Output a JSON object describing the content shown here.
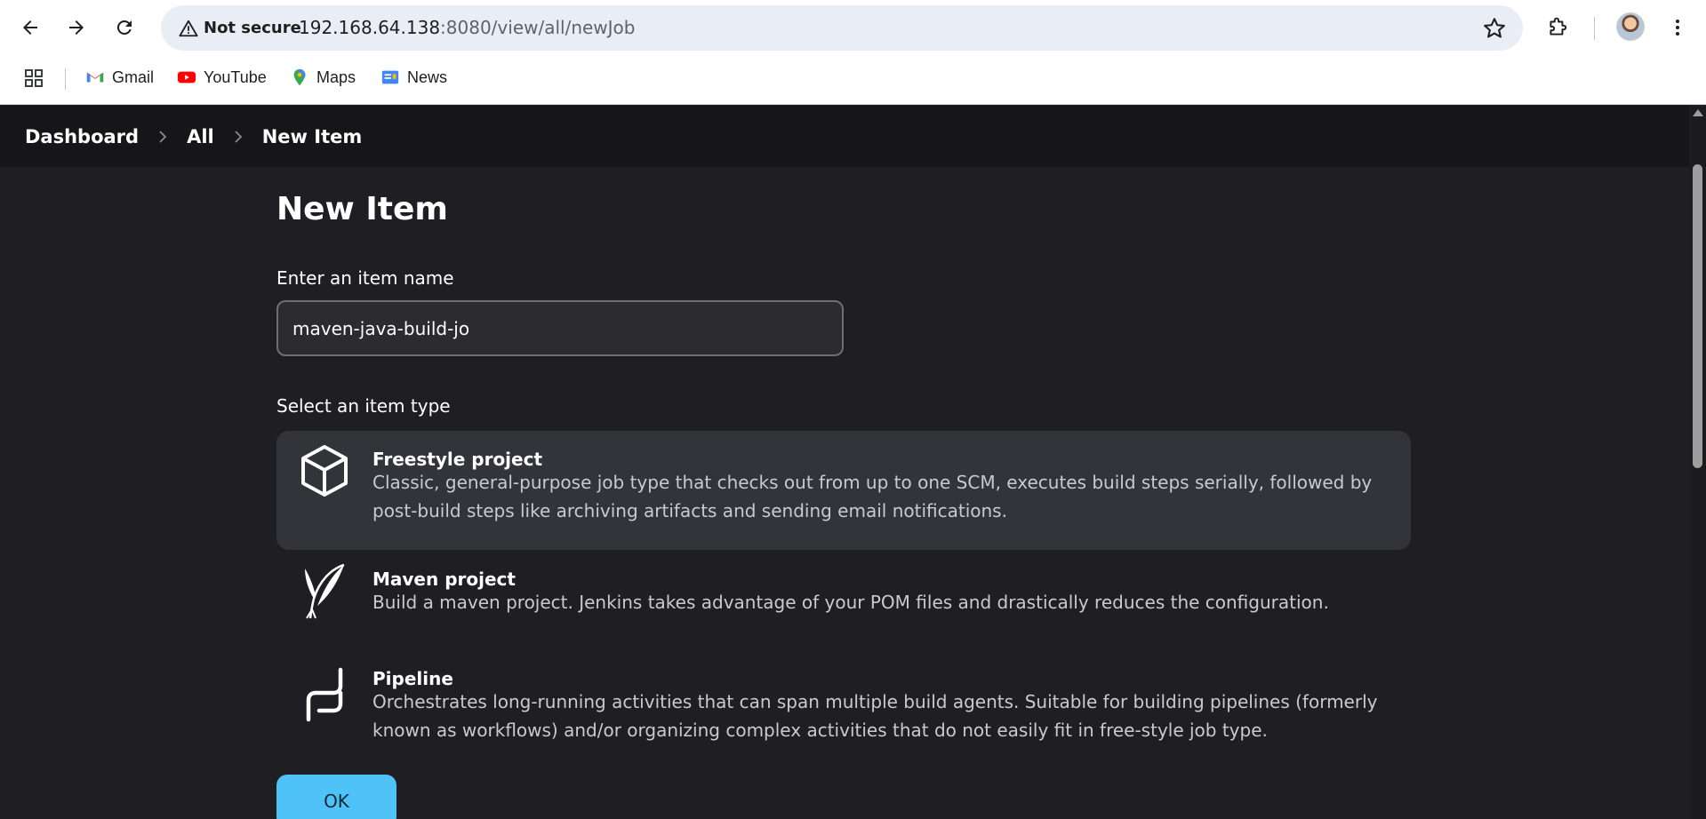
{
  "browser": {
    "security_label": "Not secure",
    "url_host": "192.168.64.138",
    "url_path": ":8080/view/all/newJob",
    "bookmarks": [
      {
        "label": "Gmail",
        "icon": "gmail-icon"
      },
      {
        "label": "YouTube",
        "icon": "youtube-icon"
      },
      {
        "label": "Maps",
        "icon": "maps-icon"
      },
      {
        "label": "News",
        "icon": "news-icon"
      }
    ]
  },
  "breadcrumb": [
    "Dashboard",
    "All",
    "New Item"
  ],
  "page": {
    "title": "New Item",
    "name_label": "Enter an item name",
    "name_value": "maven-java-build-jo",
    "type_label": "Select an item type",
    "ok_label": "OK"
  },
  "item_types": [
    {
      "title": "Freestyle project",
      "desc": "Classic, general-purpose job type that checks out from up to one SCM, executes build steps serially, followed by post-build steps like archiving artifacts and sending email notifications.",
      "icon": "freestyle-cube-icon",
      "selected": true
    },
    {
      "title": "Maven project",
      "desc": "Build a maven project. Jenkins takes advantage of your POM files and drastically reduces the configuration.",
      "icon": "maven-feather-icon",
      "selected": false
    },
    {
      "title": "Pipeline",
      "desc": "Orchestrates long-running activities that can span multiple build agents. Suitable for building pipelines (formerly known as workflows) and/or organizing complex activities that do not easily fit in free-style job type.",
      "icon": "pipeline-icon",
      "selected": false
    }
  ],
  "colors": {
    "background": "#1f1f23",
    "breadcrumb_bar": "#161619",
    "selected_item": "#33333a",
    "ok_button": "#4fc3f7"
  }
}
